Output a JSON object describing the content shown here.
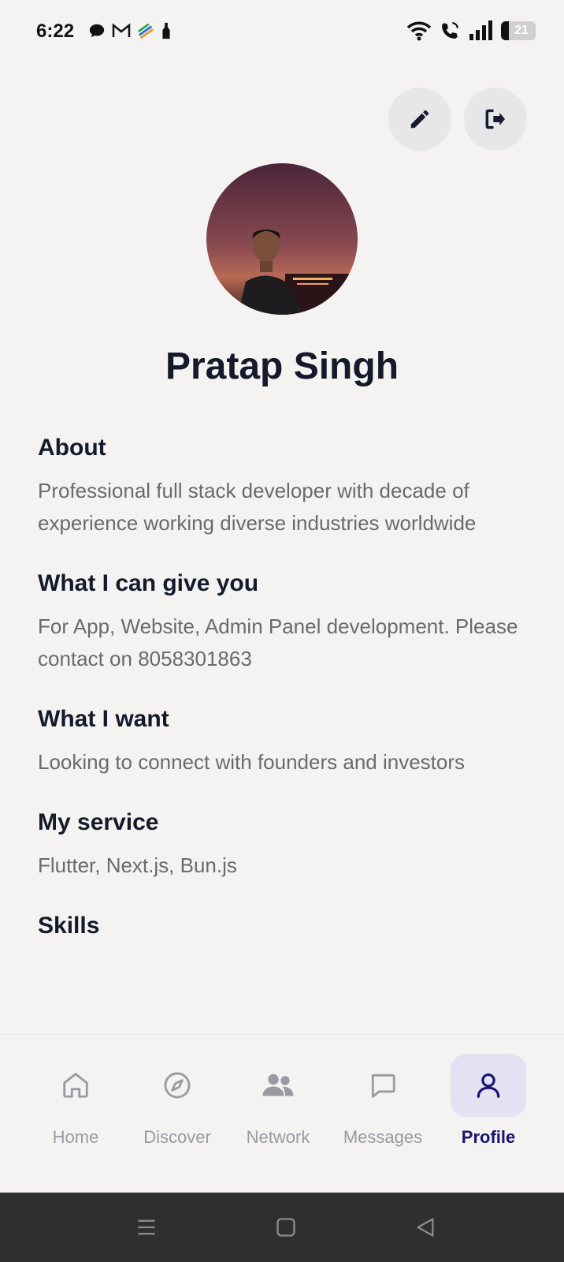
{
  "status_bar": {
    "time": "6:22",
    "battery_level": "21",
    "left_icons": [
      "chat-bubble-icon",
      "gmail-icon",
      "app-icon",
      "bottle-icon"
    ],
    "right_icons": [
      "wifi-icon",
      "call-icon",
      "signal-icon",
      "battery-icon"
    ]
  },
  "profile": {
    "name": "Pratap Singh"
  },
  "sections": [
    {
      "heading": "About",
      "body": "Professional full stack developer with decade of experience working diverse industries worldwide"
    },
    {
      "heading": "What I can give you",
      "body": "For App, Website, Admin Panel development. Please contact on 8058301863"
    },
    {
      "heading": "What I want",
      "body": "Looking to connect with founders and investors"
    },
    {
      "heading": "My service",
      "body": "Flutter, Next.js, Bun.js"
    },
    {
      "heading": "Skills",
      "body": ""
    }
  ],
  "bottom_nav": {
    "items": [
      {
        "label": "Home",
        "icon": "home-icon"
      },
      {
        "label": "Discover",
        "icon": "compass-icon"
      },
      {
        "label": "Network",
        "icon": "people-icon"
      },
      {
        "label": "Messages",
        "icon": "message-icon"
      },
      {
        "label": "Profile",
        "icon": "person-icon",
        "active": true
      }
    ]
  },
  "colors": {
    "background": "#f4f3f1",
    "text_primary": "#141a2b",
    "text_secondary": "#6a6a6f",
    "nav_active": "#1a1470",
    "nav_inactive": "#9a9aa3"
  }
}
